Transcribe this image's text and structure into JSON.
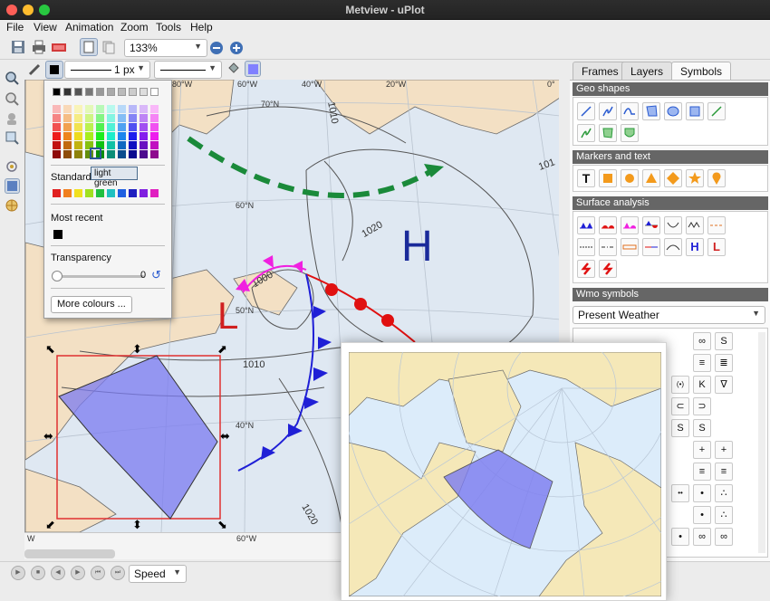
{
  "window": {
    "title": "Metview - uPlot"
  },
  "menu": {
    "items": [
      "File",
      "View",
      "Animation",
      "Zoom",
      "Tools",
      "Help"
    ]
  },
  "toolbar": {
    "zoom_value": "133%"
  },
  "line_tools": {
    "width_label": "1 px"
  },
  "popup": {
    "standard_label": "Standard",
    "tooltip": "light green",
    "most_recent_label": "Most recent",
    "transparency_label": "Transparency",
    "transparency_value": "0",
    "more_colours_label": "More colours ...",
    "transparency_level": 0
  },
  "map": {
    "lon_labels": [
      "80°W",
      "60°W",
      "40°W",
      "20°W",
      "0°"
    ],
    "bottom_lon_labels": [
      "W",
      "60°W"
    ],
    "lat_labels": [
      "70°N",
      "60°N",
      "50°N",
      "40°N"
    ],
    "isobars": [
      "1010",
      "1020",
      "1000",
      "1010",
      "1010",
      "1020",
      "101"
    ],
    "high_label": "H",
    "low_label": "L"
  },
  "panel": {
    "tabs": [
      "Frames",
      "Layers",
      "Symbols"
    ],
    "sections": {
      "geo_shapes": "Geo shapes",
      "markers_text": "Markers and text",
      "surface_analysis": "Surface analysis",
      "wmo_symbols": "Wmo symbols"
    },
    "present_weather": "Present Weather",
    "marker_text_symbol": "T",
    "surface_h": "H",
    "surface_l": "L",
    "wmo_glyphs": [
      "∞",
      "S",
      "≡",
      "≣",
      "(•)",
      "K",
      "∇",
      "⊂",
      "⊃",
      "S",
      "S",
      "+",
      "+",
      "≡",
      "≡",
      "••",
      "•",
      "∴",
      "•",
      "∴",
      "•",
      "∞",
      "∞"
    ]
  },
  "bottom": {
    "speed_label": "Speed"
  },
  "colors": {
    "accent": "#7b7bf0",
    "selection": "#e23030",
    "front_cold": "#1f1fd6",
    "front_warm": "#e01010",
    "front_green": "#1a8a3a",
    "front_magenta": "#f020e0"
  }
}
